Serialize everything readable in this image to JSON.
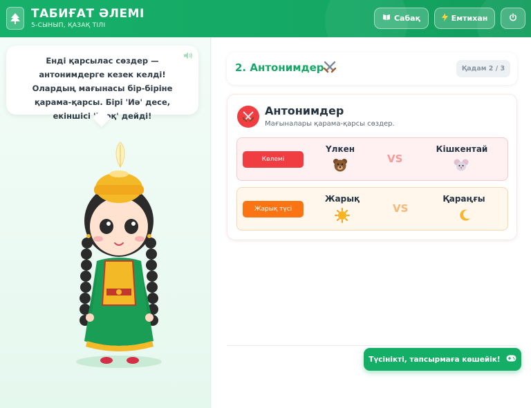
{
  "header": {
    "title": "ТАБИҒАТ ӘЛЕМІ",
    "subtitle": "5-СЫНЫП, ҚАЗАҚ ТІЛІ",
    "logo_icon": "tree-icon",
    "lesson_label": "Сабақ",
    "lesson_icon": "book-icon",
    "exam_label": "Емтихан",
    "exam_icon": "lightning-icon",
    "power_icon": "power-icon"
  },
  "assistant": {
    "message": "Енді қарсылас сөздер — антонимдерге кезек келді! Олардың мағынасы бір-біріне қарама-қарсы. Бірі 'Иә' десе, екіншісі 'Жоқ' дейді!",
    "speaker_icon": "speaker-icon"
  },
  "step": {
    "title": "2. Антонимдер",
    "icon": "crossed-swords-icon",
    "progress": "Қадам 2 / 3"
  },
  "topic": {
    "title": "Антонимдер",
    "subtitle": "Мағыналары қарама-қарсы сөздер.",
    "icon": "crossed-swords-icon"
  },
  "pairs": [
    {
      "category": "Көлемі",
      "left_word": "Үлкен",
      "left_icon": "bear-icon",
      "vs": "VS",
      "right_word": "Кішкентай",
      "right_icon": "mouse-icon"
    },
    {
      "category": "Жарық түсі",
      "left_word": "Жарық",
      "left_icon": "sun-icon",
      "vs": "VS",
      "right_word": "Қараңғы",
      "right_icon": "moon-icon"
    }
  ],
  "cta": {
    "label": "Түсінікті, тапсырмаға көшейік!",
    "icon": "gamepad-icon"
  },
  "colors": {
    "brand_green": "#14ae67",
    "red": "#ef3d42",
    "orange": "#fb7414"
  }
}
